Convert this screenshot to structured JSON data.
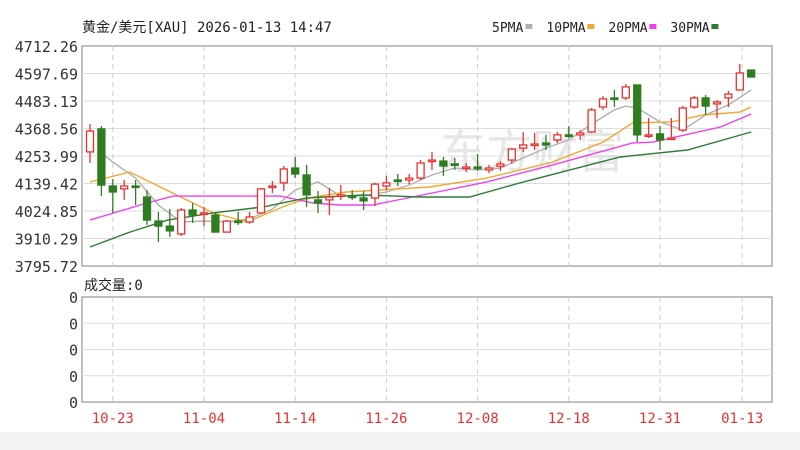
{
  "chart_data": {
    "type": "candlestick",
    "title": "黄金/美元[XAU] 2026-01-13 14:47",
    "legend": [
      {
        "name": "5PMA",
        "color": "#b0b0b0"
      },
      {
        "name": "10PMA",
        "color": "#f0a830"
      },
      {
        "name": "20PMA",
        "color": "#f040f0"
      },
      {
        "name": "30PMA",
        "color": "#2e7d32"
      }
    ],
    "legend_position": "top-right",
    "y_ticks": [
      "4712.26",
      "4597.69",
      "4483.13",
      "4368.56",
      "4253.99",
      "4139.42",
      "4024.85",
      "3910.29",
      "3795.72"
    ],
    "ylim": [
      3795.72,
      4712.26
    ],
    "x_ticks": [
      "10-23",
      "11-04",
      "11-14",
      "11-26",
      "12-08",
      "12-18",
      "12-31",
      "01-13"
    ],
    "x_tick_index": [
      3,
      11,
      19,
      27,
      35,
      43,
      51,
      59
    ],
    "up_color": "#e8322e",
    "down_color": "#2e7d20",
    "candles": [
      [
        4271,
        4387,
        4225,
        4358
      ],
      [
        4367,
        4379,
        4087,
        4133
      ],
      [
        4129,
        4158,
        4017,
        4104
      ],
      [
        4117,
        4154,
        4071,
        4129
      ],
      [
        4129,
        4154,
        4050,
        4125
      ],
      [
        4083,
        4112,
        3967,
        3987
      ],
      [
        3983,
        4021,
        3896,
        3962
      ],
      [
        3962,
        4033,
        3917,
        3942
      ],
      [
        3929,
        4037,
        3921,
        4029
      ],
      [
        4029,
        4058,
        3975,
        4008
      ],
      [
        4012,
        4042,
        3962,
        4017
      ],
      [
        4008,
        4021,
        3937,
        3937
      ],
      [
        3937,
        3987,
        3937,
        3983
      ],
      [
        3983,
        4021,
        3967,
        3979
      ],
      [
        3979,
        4021,
        3971,
        4000
      ],
      [
        4017,
        4121,
        4017,
        4117
      ],
      [
        4125,
        4150,
        4100,
        4129
      ],
      [
        4142,
        4212,
        4108,
        4200
      ],
      [
        4204,
        4250,
        4162,
        4179
      ],
      [
        4175,
        4217,
        4042,
        4092
      ],
      [
        4071,
        4108,
        4017,
        4058
      ],
      [
        4071,
        4121,
        4008,
        4083
      ],
      [
        4087,
        4133,
        4071,
        4092
      ],
      [
        4087,
        4112,
        4071,
        4083
      ],
      [
        4079,
        4108,
        4029,
        4067
      ],
      [
        4079,
        4142,
        4046,
        4137
      ],
      [
        4129,
        4171,
        4112,
        4142
      ],
      [
        4154,
        4179,
        4129,
        4150
      ],
      [
        4154,
        4179,
        4137,
        4162
      ],
      [
        4162,
        4237,
        4154,
        4225
      ],
      [
        4233,
        4271,
        4196,
        4237
      ],
      [
        4233,
        4250,
        4171,
        4212
      ],
      [
        4221,
        4246,
        4196,
        4217
      ],
      [
        4204,
        4225,
        4187,
        4208
      ],
      [
        4208,
        4262,
        4192,
        4204
      ],
      [
        4196,
        4217,
        4183,
        4204
      ],
      [
        4212,
        4233,
        4192,
        4221
      ],
      [
        4237,
        4287,
        4221,
        4283
      ],
      [
        4287,
        4354,
        4271,
        4300
      ],
      [
        4300,
        4350,
        4279,
        4304
      ],
      [
        4308,
        4342,
        4279,
        4300
      ],
      [
        4321,
        4354,
        4308,
        4342
      ],
      [
        4342,
        4379,
        4329,
        4338
      ],
      [
        4342,
        4362,
        4321,
        4350
      ],
      [
        4354,
        4454,
        4350,
        4446
      ],
      [
        4458,
        4504,
        4446,
        4492
      ],
      [
        4496,
        4529,
        4458,
        4492
      ],
      [
        4496,
        4554,
        4487,
        4542
      ],
      [
        4550,
        4550,
        4312,
        4342
      ],
      [
        4338,
        4412,
        4329,
        4342
      ],
      [
        4346,
        4379,
        4279,
        4321
      ],
      [
        4325,
        4412,
        4321,
        4329
      ],
      [
        4362,
        4462,
        4354,
        4454
      ],
      [
        4458,
        4504,
        4450,
        4496
      ],
      [
        4496,
        4508,
        4425,
        4462
      ],
      [
        4471,
        4487,
        4412,
        4479
      ],
      [
        4496,
        4525,
        4458,
        4512
      ],
      [
        4529,
        4637,
        4529,
        4600
      ],
      [
        4612,
        4612,
        4583,
        4583
      ]
    ],
    "ma": {
      "5PMA": [
        [
          2,
          4267
        ],
        [
          3,
          4229
        ],
        [
          5,
          4162
        ],
        [
          7,
          4050
        ],
        [
          9,
          3979
        ],
        [
          11,
          3983
        ],
        [
          13,
          3979
        ],
        [
          15,
          3992
        ],
        [
          17,
          4033
        ],
        [
          19,
          4112
        ],
        [
          21,
          4146
        ],
        [
          23,
          4087
        ],
        [
          25,
          4087
        ],
        [
          27,
          4104
        ],
        [
          29,
          4133
        ],
        [
          31,
          4175
        ],
        [
          33,
          4204
        ],
        [
          35,
          4196
        ],
        [
          37,
          4204
        ],
        [
          39,
          4246
        ],
        [
          41,
          4287
        ],
        [
          43,
          4321
        ],
        [
          45,
          4387
        ],
        [
          47,
          4446
        ],
        [
          48,
          4462
        ],
        [
          49,
          4454
        ],
        [
          51,
          4396
        ],
        [
          53,
          4362
        ],
        [
          55,
          4425
        ],
        [
          57,
          4467
        ],
        [
          59,
          4529
        ]
      ],
      "10PMA": [
        [
          1,
          4146
        ],
        [
          4.5,
          4187
        ],
        [
          11.8,
          4017
        ],
        [
          14.8,
          3979
        ],
        [
          18.3,
          4050
        ],
        [
          20.6,
          4083
        ],
        [
          23.5,
          4104
        ],
        [
          30.8,
          4125
        ],
        [
          35.8,
          4162
        ],
        [
          41.6,
          4229
        ],
        [
          46,
          4312
        ],
        [
          48.6,
          4392
        ],
        [
          52,
          4396
        ],
        [
          54.8,
          4425
        ],
        [
          58,
          4437
        ],
        [
          59,
          4458
        ]
      ],
      "20PMA": [
        [
          1,
          3987
        ],
        [
          6,
          4058
        ],
        [
          8.3,
          4087
        ],
        [
          11.5,
          4087
        ],
        [
          17.7,
          4087
        ],
        [
          20.6,
          4058
        ],
        [
          22.9,
          4050
        ],
        [
          25.8,
          4050
        ],
        [
          29.3,
          4083
        ],
        [
          35.8,
          4146
        ],
        [
          41.6,
          4217
        ],
        [
          48.6,
          4308
        ],
        [
          50.4,
          4312
        ],
        [
          56.3,
          4375
        ],
        [
          59,
          4429
        ]
      ],
      "30PMA": [
        [
          1,
          3875
        ],
        [
          4.5,
          3937
        ],
        [
          7.8,
          3987
        ],
        [
          11.8,
          4017
        ],
        [
          16.2,
          4042
        ],
        [
          20,
          4079
        ],
        [
          24.9,
          4092
        ],
        [
          29.9,
          4083
        ],
        [
          34.3,
          4083
        ],
        [
          38.7,
          4142
        ],
        [
          47.5,
          4250
        ],
        [
          53.4,
          4279
        ],
        [
          59,
          4354
        ]
      ]
    },
    "volume": {
      "label": "成交量:0",
      "y_ticks": [
        "0",
        "0",
        "0",
        "0",
        "0"
      ],
      "values": []
    },
    "watermark": "东方财富"
  }
}
